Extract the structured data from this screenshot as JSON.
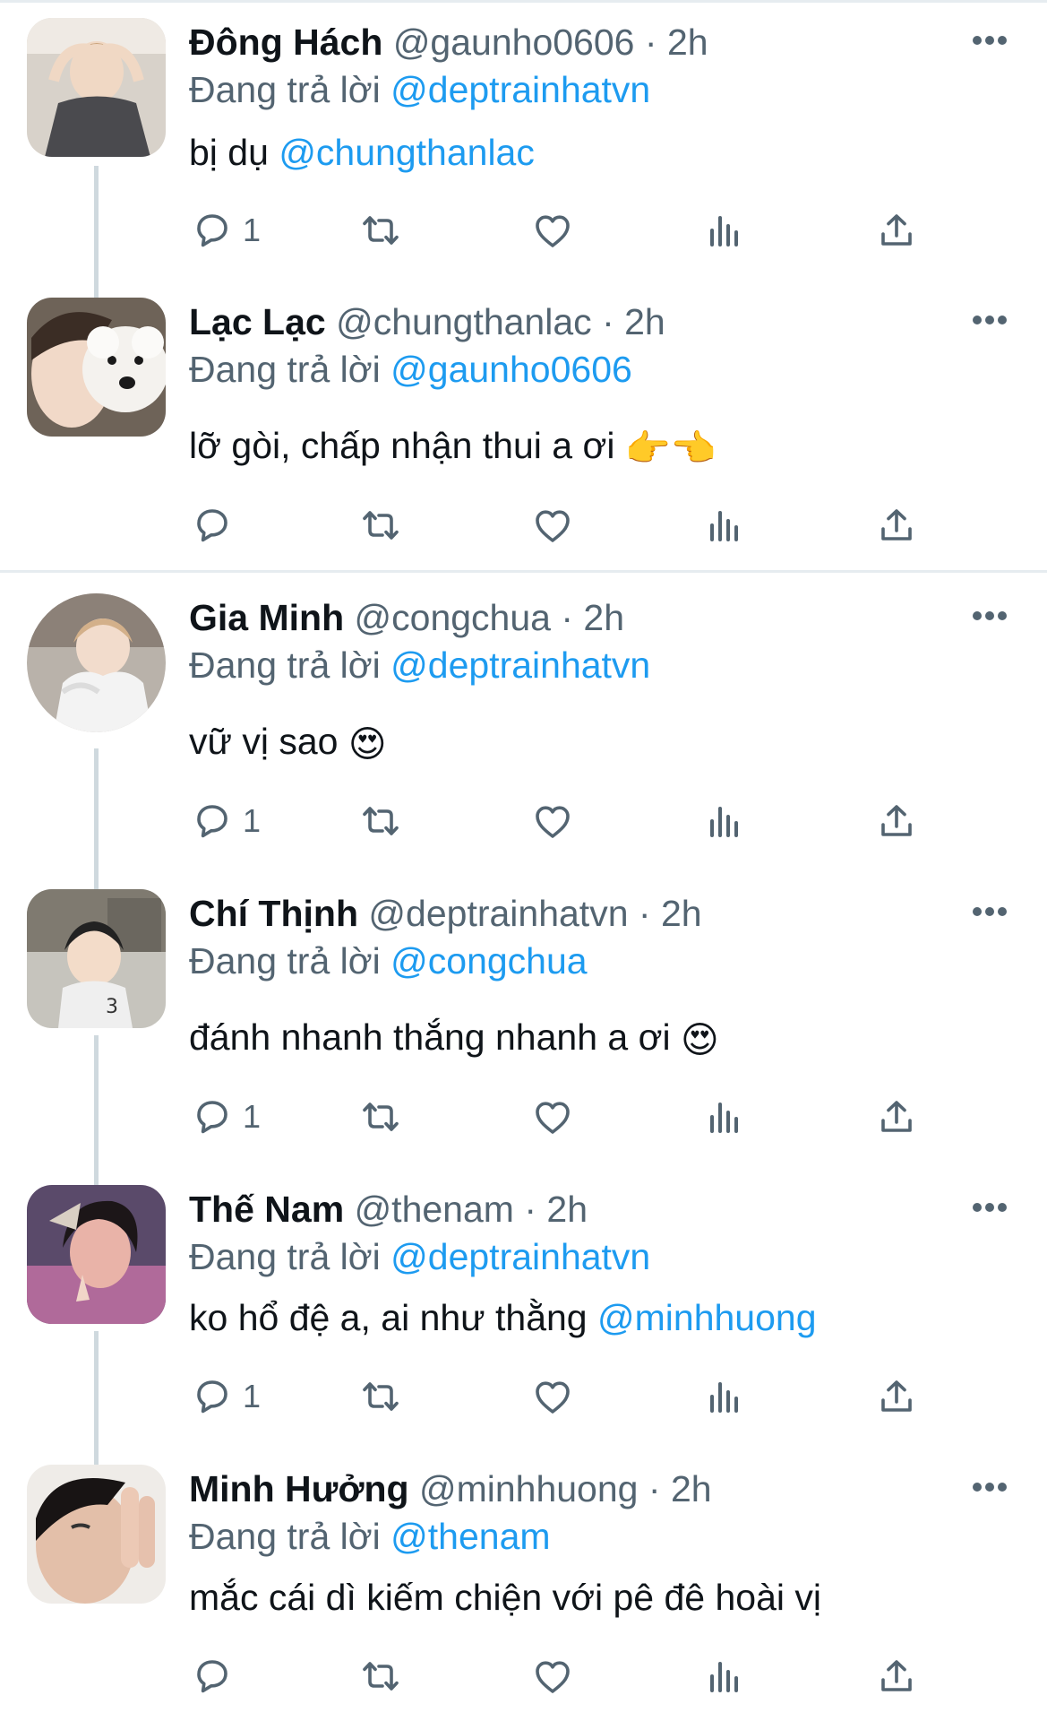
{
  "replying_prefix": "Đang trả lời",
  "colors": {
    "mention": "#1d9bf0",
    "muted": "#536471",
    "line": "#cfd9de",
    "heart_eyes": "#fcc21b"
  },
  "icons": [
    "reply-icon",
    "retweet-icon",
    "like-icon",
    "views-icon",
    "share-icon",
    "more-icon"
  ],
  "tweets": [
    {
      "name": "Đông Hách",
      "handle": "@gaunho0606",
      "sep": "·",
      "time": "2h",
      "replying_to": "@deptrainhatvn",
      "text": "bị dụ ",
      "mention": "@chungthanlac",
      "emoji": "",
      "reply_count": "1"
    },
    {
      "name": "Lạc Lạc",
      "handle": "@chungthanlac",
      "sep": "·",
      "time": "2h",
      "replying_to": "@gaunho0606",
      "text": "lỡ gòi, chấp nhận thui a ơi ",
      "mention": "",
      "emoji": "👉👈",
      "reply_count": ""
    },
    {
      "name": "Gia Minh",
      "handle": "@congchua",
      "sep": "·",
      "time": "2h",
      "replying_to": "@deptrainhatvn",
      "text": "vữ vị sao ",
      "mention": "",
      "emoji": "😍",
      "reply_count": "1"
    },
    {
      "name": "Chí Thịnh",
      "handle": "@deptrainhatvn",
      "sep": "·",
      "time": "2h",
      "replying_to": "@congchua",
      "text": "đánh nhanh thắng nhanh a ơi ",
      "mention": "",
      "emoji": "😍",
      "reply_count": "1"
    },
    {
      "name": "Thế Nam",
      "handle": "@thenam",
      "sep": "·",
      "time": "2h",
      "replying_to": "@deptrainhatvn",
      "text": "ko hổ đệ a, ai như thằng ",
      "mention": "@minhhuong",
      "emoji": "",
      "reply_count": "1"
    },
    {
      "name": "Minh Hưởng",
      "handle": "@minhhuong",
      "sep": "·",
      "time": "2h",
      "replying_to": "@thenam",
      "text": "mắc cái dì kiếm chiện với pê đê hoài vị",
      "mention": "",
      "emoji": "",
      "reply_count": ""
    }
  ]
}
